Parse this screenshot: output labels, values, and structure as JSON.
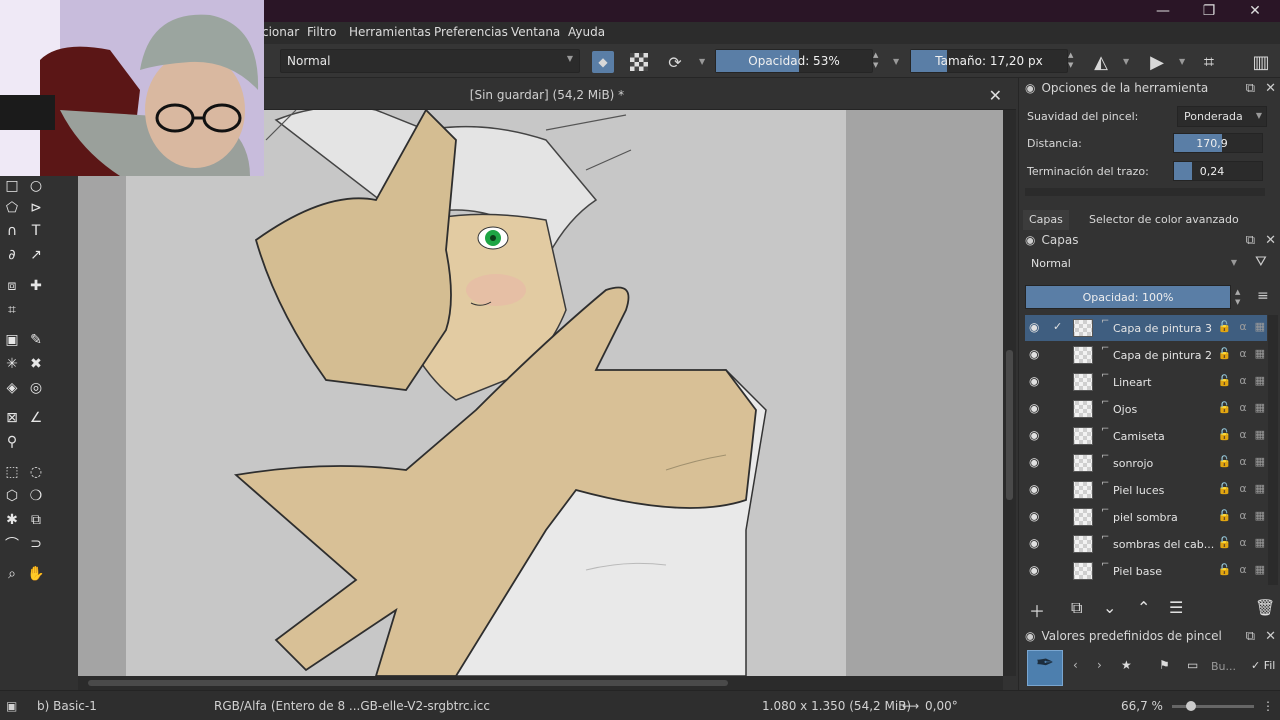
{
  "window": {
    "minimize": "—",
    "maximize": "❐",
    "close": "✕"
  },
  "menu": {
    "items": [
      "cionar",
      "Filtro",
      "Herramientas",
      "Preferencias",
      "Ventana",
      "Ayuda"
    ]
  },
  "toolbar": {
    "blend_mode": "Normal",
    "opacity_label": "Opacidad: 53%",
    "opacity_value": 0.53,
    "size_label": "Tamaño: 17,20 px"
  },
  "document": {
    "tab_title": "[Sin guardar]  (54,2 MiB) *"
  },
  "tool_options": {
    "title": "Opciones de la herramienta",
    "smoothing_label": "Suavidad del pincel:",
    "smoothing_value": "Ponderada",
    "distance_label": "Distancia:",
    "distance_value": "170,9",
    "stroke_end_label": "Terminación del trazo:",
    "stroke_end_value": "0,24"
  },
  "tabs": {
    "layers": "Capas",
    "color_selector": "Selector de color avanzado"
  },
  "layers_panel": {
    "title": "Capas",
    "blend_mode": "Normal",
    "opacity_label": "Opacidad:  100%",
    "layers": [
      {
        "name": "Capa de pintura 3",
        "selected": true
      },
      {
        "name": "Capa de pintura 2",
        "selected": false
      },
      {
        "name": "Lineart",
        "selected": false
      },
      {
        "name": "Ojos",
        "selected": false
      },
      {
        "name": "Camiseta",
        "selected": false
      },
      {
        "name": "sonrojo",
        "selected": false
      },
      {
        "name": "Piel luces",
        "selected": false
      },
      {
        "name": "piel sombra",
        "selected": false
      },
      {
        "name": "sombras del cab...",
        "selected": false
      },
      {
        "name": "Piel base",
        "selected": false
      }
    ]
  },
  "brush_presets": {
    "title": "Valores predefinidos de pincel",
    "search_placeholder": "Bu...",
    "filter_label": "Fil"
  },
  "status": {
    "brush": "b) Basic-1",
    "color_space": "RGB/Alfa (Entero de 8 ...GB-elle-V2-srgbtrc.icc",
    "dimensions": "1.080 x 1.350 (54,2 MiB)",
    "rotation": "0,00°",
    "zoom": "66,7 %"
  }
}
